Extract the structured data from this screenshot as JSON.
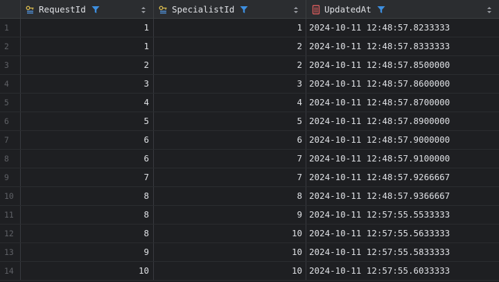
{
  "columns": {
    "c1": {
      "label": "RequestId",
      "icon": "key-column-icon"
    },
    "c2": {
      "label": "SpecialistId",
      "icon": "key-column-icon"
    },
    "c3": {
      "label": "UpdatedAt",
      "icon": "column-icon"
    }
  },
  "rows": [
    {
      "n": "1",
      "request": "1",
      "specialist": "1",
      "updated": "2024-10-11 12:48:57.8233333"
    },
    {
      "n": "2",
      "request": "1",
      "specialist": "2",
      "updated": "2024-10-11 12:48:57.8333333"
    },
    {
      "n": "3",
      "request": "2",
      "specialist": "2",
      "updated": "2024-10-11 12:48:57.8500000"
    },
    {
      "n": "4",
      "request": "3",
      "specialist": "3",
      "updated": "2024-10-11 12:48:57.8600000"
    },
    {
      "n": "5",
      "request": "4",
      "specialist": "4",
      "updated": "2024-10-11 12:48:57.8700000"
    },
    {
      "n": "6",
      "request": "5",
      "specialist": "5",
      "updated": "2024-10-11 12:48:57.8900000"
    },
    {
      "n": "7",
      "request": "6",
      "specialist": "6",
      "updated": "2024-10-11 12:48:57.9000000"
    },
    {
      "n": "8",
      "request": "6",
      "specialist": "7",
      "updated": "2024-10-11 12:48:57.9100000"
    },
    {
      "n": "9",
      "request": "7",
      "specialist": "7",
      "updated": "2024-10-11 12:48:57.9266667"
    },
    {
      "n": "10",
      "request": "8",
      "specialist": "8",
      "updated": "2024-10-11 12:48:57.9366667"
    },
    {
      "n": "11",
      "request": "8",
      "specialist": "9",
      "updated": "2024-10-11 12:57:55.5533333"
    },
    {
      "n": "12",
      "request": "8",
      "specialist": "10",
      "updated": "2024-10-11 12:57:55.5633333"
    },
    {
      "n": "13",
      "request": "9",
      "specialist": "10",
      "updated": "2024-10-11 12:57:55.5833333"
    },
    {
      "n": "14",
      "request": "10",
      "specialist": "10",
      "updated": "2024-10-11 12:57:55.6033333"
    }
  ],
  "colors": {
    "background": "#1e1f22",
    "header": "#2b2d30",
    "filter": "#3d8fe0",
    "key": "#d6b94f",
    "column": "#d55b5b"
  }
}
